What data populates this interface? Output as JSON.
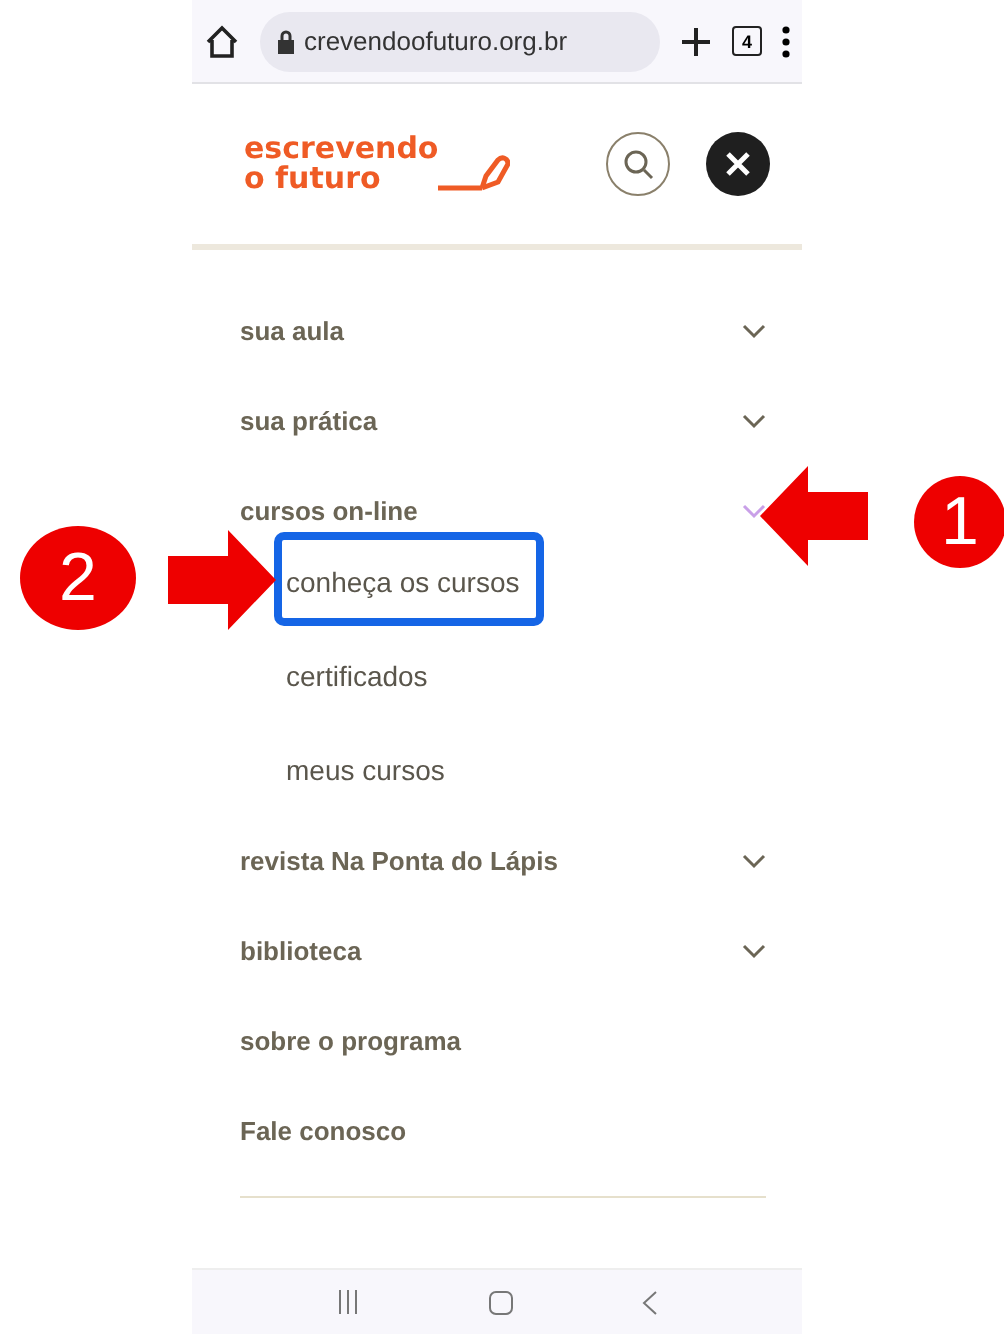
{
  "browser": {
    "url": "crevendoofuturo.org.br",
    "tab_count": "4"
  },
  "logo": {
    "line_1": "escrevendo",
    "line_2": "o futuro"
  },
  "menu": [
    {
      "label": "sua aula",
      "expanded": false
    },
    {
      "label": "sua prática",
      "expanded": false
    },
    {
      "label": "cursos on-line",
      "expanded": true,
      "children": [
        {
          "label": "conheça os cursos",
          "highlighted": true
        },
        {
          "label": "certificados",
          "highlighted": false
        },
        {
          "label": "meus cursos",
          "highlighted": false
        }
      ]
    },
    {
      "label": "revista Na Ponta do Lápis",
      "expanded": false
    },
    {
      "label": "biblioteca",
      "expanded": false
    },
    {
      "label": "sobre o programa"
    },
    {
      "label": "Fale conosco"
    }
  ],
  "callouts": [
    {
      "number": "1"
    },
    {
      "number": "2"
    }
  ]
}
